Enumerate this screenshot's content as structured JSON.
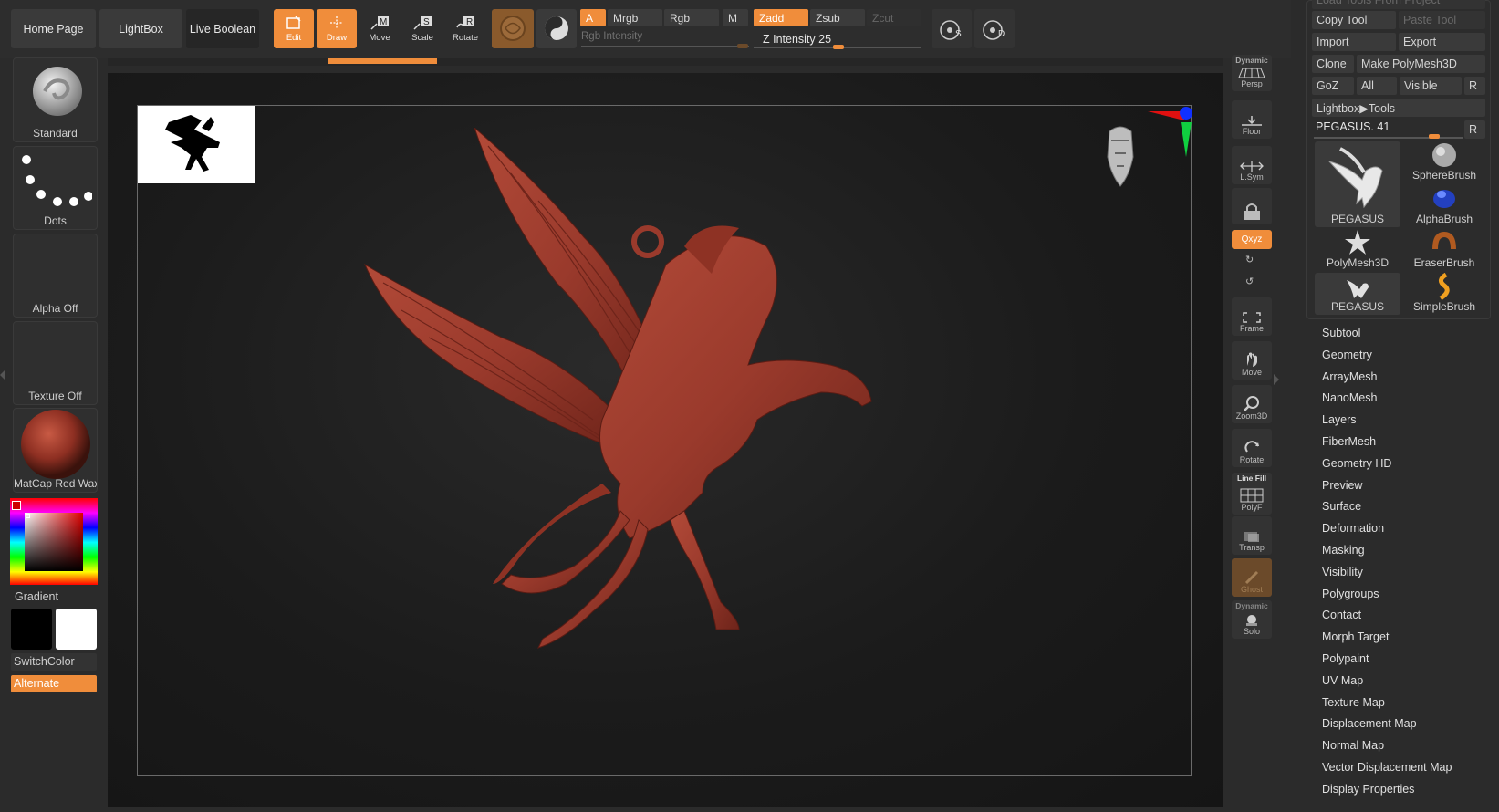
{
  "top_nav": {
    "home": "Home Page",
    "lightbox": "LightBox",
    "live_boolean": "Live Boolean"
  },
  "tools": {
    "edit": "Edit",
    "draw": "Draw",
    "move": "Move",
    "scale": "Scale",
    "rotate": "Rotate"
  },
  "channels": {
    "a": "A",
    "mrgb": "Mrgb",
    "rgb": "Rgb",
    "m": "M",
    "zadd": "Zadd",
    "zsub": "Zsub",
    "zcut": "Zcut"
  },
  "sliders": {
    "rgb_intensity": "Rgb Intensity",
    "z_intensity": "Z Intensity 25",
    "z_intensity_value": 25
  },
  "left_panel": {
    "brush": "Standard",
    "stroke": "Dots",
    "alpha": "Alpha Off",
    "texture": "Texture Off",
    "material": "MatCap Red Wax",
    "gradient": "Gradient",
    "switch_color": "SwitchColor",
    "alternate": "Alternate"
  },
  "right_strip": {
    "dynamic_top": "Dynamic",
    "persp": "Persp",
    "floor": "Floor",
    "lsym": "L.Sym",
    "xyz": "Qxyz",
    "frame": "Frame",
    "move": "Move",
    "zoom3d": "Zoom3D",
    "rotate": "Rotate",
    "line_fill": "Line Fill",
    "polyf": "PolyF",
    "transp": "Transp",
    "ghost": "Ghost",
    "dynamic_bottom": "Dynamic",
    "solo": "Solo"
  },
  "tool_panel": {
    "load_tools": "Load Tools From Project",
    "copy_tool": "Copy Tool",
    "paste_tool": "Paste Tool",
    "import": "Import",
    "export": "Export",
    "clone": "Clone",
    "make_polymesh": "Make PolyMesh3D",
    "goz": "GoZ",
    "all": "All",
    "visible": "Visible",
    "r": "R",
    "lightbox_tools": "Lightbox▶Tools",
    "current_tool": "PEGASUS. 41",
    "current_r": "R",
    "thumbs": [
      "PEGASUS",
      "SphereBrush",
      "AlphaBrush",
      "PolyMesh3D",
      "EraserBrush",
      "PEGASUS",
      "SimpleBrush"
    ]
  },
  "tool_menu": [
    "Subtool",
    "Geometry",
    "ArrayMesh",
    "NanoMesh",
    "Layers",
    "FiberMesh",
    "Geometry HD",
    "Preview",
    "Surface",
    "Deformation",
    "Masking",
    "Visibility",
    "Polygroups",
    "Contact",
    "Morph Target",
    "Polypaint",
    "UV Map",
    "Texture Map",
    "Displacement Map",
    "Normal Map",
    "Vector Displacement Map",
    "Display Properties"
  ],
  "colors": {
    "accent": "#f08d3b",
    "model_red": "#9a3a2c",
    "bg": "#2b2b2b"
  }
}
